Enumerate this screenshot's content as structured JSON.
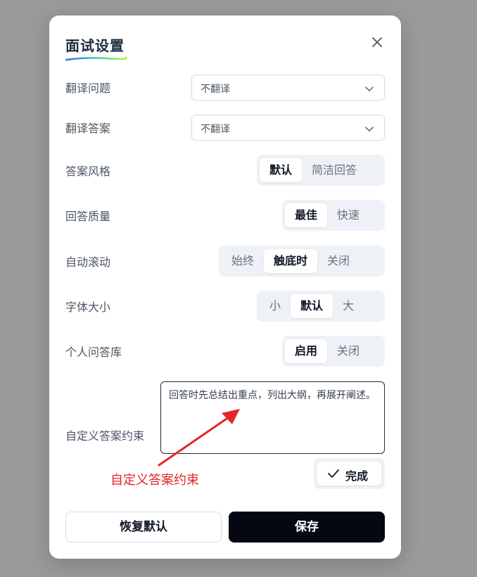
{
  "modal": {
    "title": "面试设置"
  },
  "translate_question": {
    "label": "翻译问题",
    "value": "不翻译"
  },
  "translate_answer": {
    "label": "翻译答案",
    "value": "不翻译"
  },
  "answer_style": {
    "label": "答案风格",
    "options": [
      "默认",
      "简洁回答"
    ],
    "selected": "默认"
  },
  "answer_quality": {
    "label": "回答质量",
    "options": [
      "最佳",
      "快速"
    ],
    "selected": "最佳"
  },
  "auto_scroll": {
    "label": "自动滚动",
    "options": [
      "始终",
      "触底时",
      "关闭"
    ],
    "selected": "触底时"
  },
  "font_size": {
    "label": "字体大小",
    "options": [
      "小",
      "默认",
      "大"
    ],
    "selected": "默认"
  },
  "personal_qa": {
    "label": "个人问答库",
    "options": [
      "启用",
      "关闭"
    ],
    "selected": "启用"
  },
  "custom_constraint": {
    "label": "自定义答案约束",
    "value": "回答时先总结出重点，列出大纲，再展开阐述。",
    "done_label": "完成"
  },
  "annotation": {
    "text": "自定义答案约束",
    "color": "#e3262b"
  },
  "footer": {
    "reset_label": "恢复默认",
    "save_label": "保存"
  },
  "colors": {
    "primary_button": "#050812",
    "segment_bg": "#eef1f6"
  }
}
